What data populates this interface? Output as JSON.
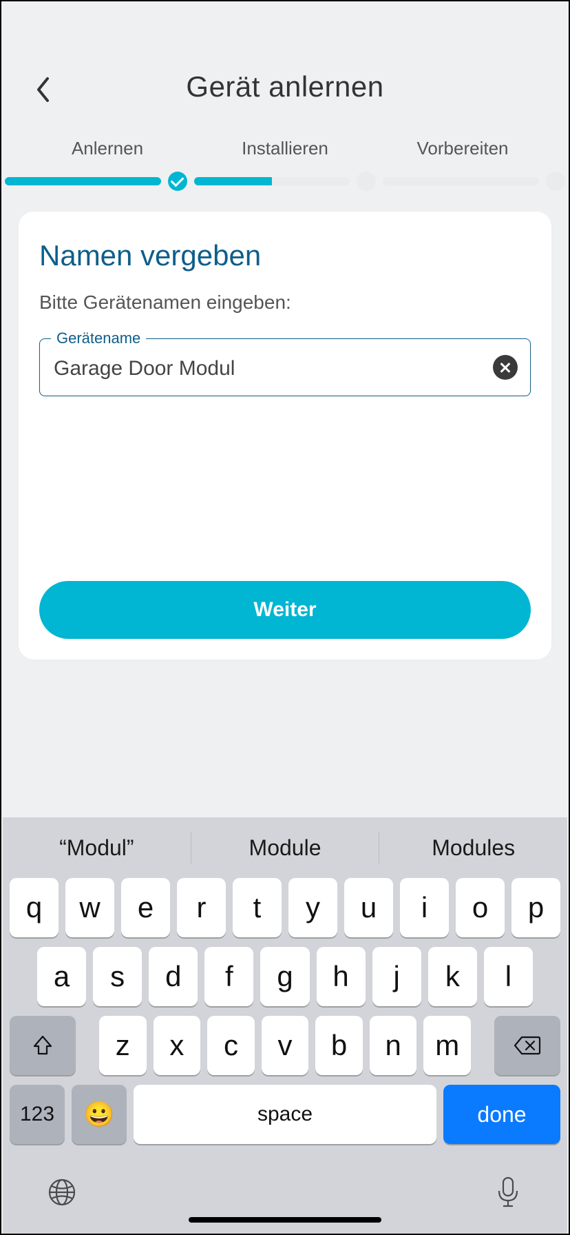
{
  "header": {
    "title": "Gerät anlernen"
  },
  "stepper": {
    "steps": [
      "Anlernen",
      "Installieren",
      "Vorbereiten"
    ]
  },
  "card": {
    "title": "Namen vergeben",
    "subtitle": "Bitte Gerätenamen eingeben:",
    "field_label": "Gerätename",
    "field_value": "Garage Door Modul",
    "button": "Weiter"
  },
  "keyboard": {
    "suggestions": [
      "“Modul”",
      "Module",
      "Modules"
    ],
    "row1": [
      "q",
      "w",
      "e",
      "r",
      "t",
      "y",
      "u",
      "i",
      "o",
      "p"
    ],
    "row2": [
      "a",
      "s",
      "d",
      "f",
      "g",
      "h",
      "j",
      "k",
      "l"
    ],
    "row3": [
      "z",
      "x",
      "c",
      "v",
      "b",
      "n",
      "m"
    ],
    "num_key": "123",
    "space_key": "space",
    "done_key": "done"
  }
}
